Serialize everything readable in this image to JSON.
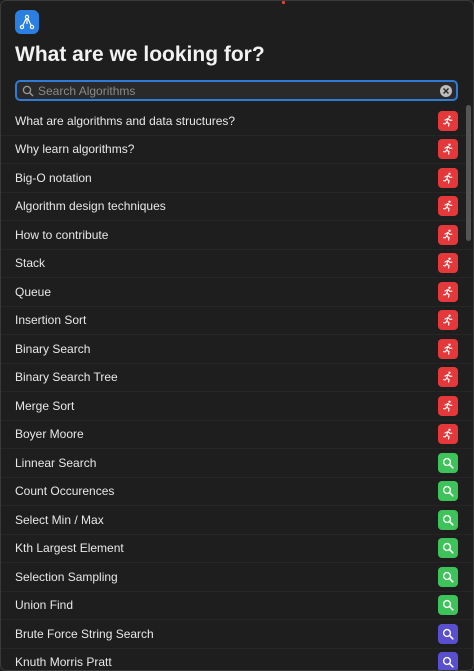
{
  "header": {
    "title": "What are we looking for?"
  },
  "search": {
    "placeholder": "Search Algorithms",
    "value": ""
  },
  "colors": {
    "red": "#e5383b",
    "green": "#3ec35a",
    "purple": "#5a4fcf",
    "accent": "#2f7bd6"
  },
  "items": [
    {
      "label": "What are algorithms and data structures?",
      "badge": "red",
      "icon": "runner-icon"
    },
    {
      "label": "Why learn algorithms?",
      "badge": "red",
      "icon": "runner-icon"
    },
    {
      "label": "Big-O notation",
      "badge": "red",
      "icon": "runner-icon"
    },
    {
      "label": "Algorithm design techniques",
      "badge": "red",
      "icon": "runner-icon"
    },
    {
      "label": "How to contribute",
      "badge": "red",
      "icon": "runner-icon"
    },
    {
      "label": "Stack",
      "badge": "red",
      "icon": "runner-icon"
    },
    {
      "label": "Queue",
      "badge": "red",
      "icon": "runner-icon"
    },
    {
      "label": "Insertion Sort",
      "badge": "red",
      "icon": "runner-icon"
    },
    {
      "label": "Binary Search",
      "badge": "red",
      "icon": "runner-icon"
    },
    {
      "label": "Binary Search Tree",
      "badge": "red",
      "icon": "runner-icon"
    },
    {
      "label": "Merge Sort",
      "badge": "red",
      "icon": "runner-icon"
    },
    {
      "label": "Boyer Moore",
      "badge": "red",
      "icon": "runner-icon"
    },
    {
      "label": "Linnear Search",
      "badge": "green",
      "icon": "magnifier-icon"
    },
    {
      "label": "Count Occurences",
      "badge": "green",
      "icon": "magnifier-icon"
    },
    {
      "label": "Select Min / Max",
      "badge": "green",
      "icon": "magnifier-icon"
    },
    {
      "label": "Kth Largest Element",
      "badge": "green",
      "icon": "magnifier-icon"
    },
    {
      "label": "Selection Sampling",
      "badge": "green",
      "icon": "magnifier-icon"
    },
    {
      "label": "Union Find",
      "badge": "green",
      "icon": "magnifier-icon"
    },
    {
      "label": "Brute Force String Search",
      "badge": "purple",
      "icon": "magnifier-icon"
    },
    {
      "label": "Knuth Morris Pratt",
      "badge": "purple",
      "icon": "magnifier-icon"
    }
  ]
}
